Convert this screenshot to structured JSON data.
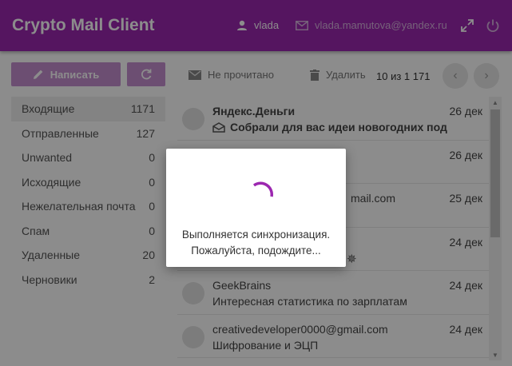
{
  "header": {
    "app_title": "Crypto Mail Client",
    "username": "vlada",
    "email": "vlada.mamutova@yandex.ru",
    "icons": [
      "user-icon",
      "mail-icon",
      "fullscreen-icon",
      "power-icon"
    ],
    "color": "#9c27b0"
  },
  "toolbar": {
    "compose_label": "Написать",
    "unread_label": "Не прочитано",
    "delete_label": "Удалить",
    "pager": "10 из 1 171",
    "icons": [
      "pencil-icon",
      "refresh-icon",
      "envelope-icon",
      "trash-icon",
      "chevron-left-icon",
      "chevron-right-icon"
    ]
  },
  "folders": [
    {
      "name": "Входящие",
      "count": "1171"
    },
    {
      "name": "Отправленные",
      "count": "127"
    },
    {
      "name": "Unwanted",
      "count": "0"
    },
    {
      "name": "Исходящие",
      "count": "0"
    },
    {
      "name": "Нежелательная почта",
      "count": "0"
    },
    {
      "name": "Спам",
      "count": "0"
    },
    {
      "name": "Удаленные",
      "count": "20"
    },
    {
      "name": "Черновики",
      "count": "2"
    }
  ],
  "mails": [
    {
      "sender": "Яндекс.Деньги",
      "subject": "Собрали для вас идеи новогодних под",
      "date": "26 дек",
      "unread": true
    },
    {
      "sender": "",
      "subject": "",
      "date": "26 дек",
      "unread": false
    },
    {
      "sender": "mail.com",
      "subject": "",
      "date": "25 дек",
      "unread": false
    },
    {
      "sender": "",
      "subject": "",
      "date": "24 дек",
      "unread": false
    },
    {
      "sender": "GeekBrains",
      "subject": "Интересная статистика по зарплатам",
      "date": "24 дек",
      "unread": false
    },
    {
      "sender": "creativedeveloper0000@gmail.com",
      "subject": "Шифрование и ЭЦП",
      "date": "24 дек",
      "unread": false
    }
  ],
  "dialog": {
    "line1": "Выполняется синхронизация.",
    "line2": "Пожалуйста, подождите..."
  },
  "colors": {
    "accent": "#9c27b0",
    "overlay": "rgba(0,0,0,0.45)"
  }
}
